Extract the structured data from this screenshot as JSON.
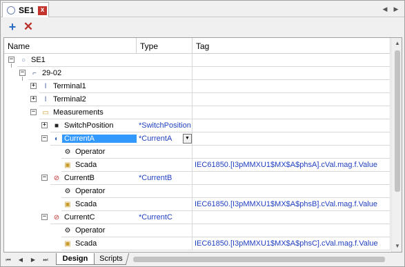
{
  "tab": {
    "title": "SE1",
    "close_label": "x"
  },
  "strip": {
    "left_label": "◀",
    "right_label": "▶"
  },
  "toolbar": {
    "add_label": "+",
    "delete_label": "✕"
  },
  "columns": {
    "name": "Name",
    "type": "Type",
    "tag": "Tag"
  },
  "rows": [
    {
      "name": "SE1",
      "type": "",
      "tag": "",
      "icon": "substation-icon"
    },
    {
      "name": "29-02",
      "type": "",
      "tag": "",
      "icon": "feeder-icon"
    },
    {
      "name": "Terminal1",
      "type": "",
      "tag": "",
      "icon": "terminal-icon"
    },
    {
      "name": "Terminal2",
      "type": "",
      "tag": "",
      "icon": "terminal-icon"
    },
    {
      "name": "Measurements",
      "type": "",
      "tag": "",
      "icon": "folder-icon"
    },
    {
      "name": "SwitchPosition",
      "type": "*SwitchPosition",
      "tag": "",
      "icon": "discrete-measurement-icon"
    },
    {
      "name": "CurrentA",
      "type": "*CurrentA",
      "tag": "",
      "icon": "analog-measurement-icon"
    },
    {
      "name": "Operator",
      "type": "",
      "tag": "",
      "icon": "operator-icon"
    },
    {
      "name": "Scada",
      "type": "",
      "tag": "IEC61850.[I3pMMXU1$MX$A$phsA].cVal.mag.f.Value",
      "icon": "scada-icon"
    },
    {
      "name": "CurrentB",
      "type": "*CurrentB",
      "tag": "",
      "icon": "analog-measurement-icon"
    },
    {
      "name": "Operator",
      "type": "",
      "tag": "",
      "icon": "operator-icon"
    },
    {
      "name": "Scada",
      "type": "",
      "tag": "IEC61850.[I3pMMXU1$MX$A$phsB].cVal.mag.f.Value",
      "icon": "scada-icon"
    },
    {
      "name": "CurrentC",
      "type": "*CurrentC",
      "tag": "",
      "icon": "analog-measurement-icon"
    },
    {
      "name": "Operator",
      "type": "",
      "tag": "",
      "icon": "operator-icon"
    },
    {
      "name": "Scada",
      "type": "",
      "tag": "IEC61850.[I3pMMXU1$MX$A$phsC].cVal.mag.f.Value",
      "icon": "scada-icon"
    }
  ],
  "bottom_tabs": {
    "design": "Design",
    "scripts": "Scripts"
  },
  "nav": {
    "first": "⏮",
    "prev": "◀",
    "next": "▶",
    "last": "⏭"
  },
  "colors": {
    "selection": "#3399ff",
    "link": "#2040c0",
    "close": "#c4342c",
    "add": "#2a6cc4"
  }
}
